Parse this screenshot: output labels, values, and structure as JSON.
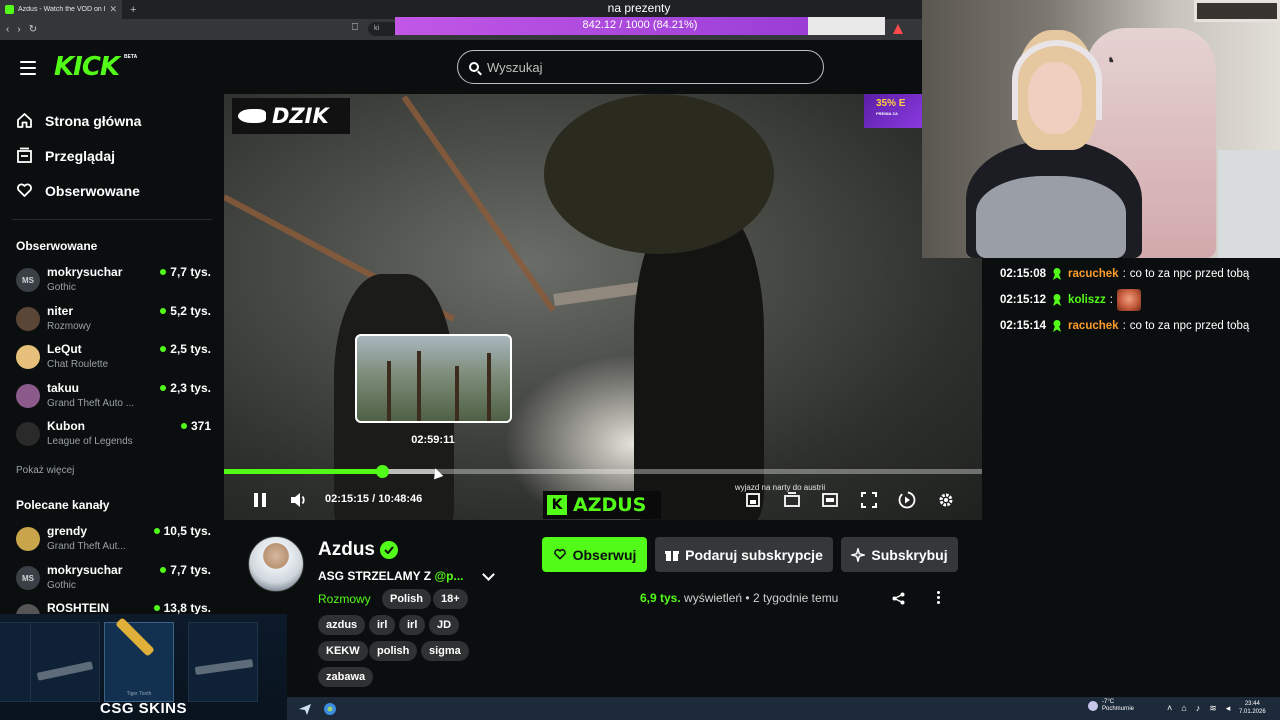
{
  "browser": {
    "tab_title": "Azdus - Watch the VOD on K",
    "url_fragment": "ki"
  },
  "goal_overlay": {
    "label": "na prezenty",
    "progress_text": "842.12 / 1000 (84.21%)",
    "progress_fraction": 0.8421
  },
  "header": {
    "logo": "KICK",
    "beta": "BETA",
    "search_placeholder": "Wyszukaj"
  },
  "sidebar": {
    "nav": [
      {
        "label": "Strona główna",
        "icon": "home-icon"
      },
      {
        "label": "Przeglądaj",
        "icon": "browse-icon"
      },
      {
        "label": "Obserwowane",
        "icon": "heart-icon"
      }
    ],
    "followed_title": "Obserwowane",
    "followed": [
      {
        "name": "mokrysuchar",
        "category": "Gothic",
        "viewers": "7,7 tys.",
        "initials": "MS"
      },
      {
        "name": "niter",
        "category": "Rozmowy",
        "viewers": "5,2 tys.",
        "initials": ""
      },
      {
        "name": "LeQut",
        "category": "Chat Roulette",
        "viewers": "2,5 tys.",
        "initials": ""
      },
      {
        "name": "takuu",
        "category": "Grand Theft Auto ...",
        "viewers": "2,3 tys.",
        "initials": ""
      },
      {
        "name": "Kubon",
        "category": "League of Legends",
        "viewers": "371",
        "initials": ""
      }
    ],
    "show_more": "Pokaż więcej",
    "recommended_title": "Polecane kanały",
    "recommended": [
      {
        "name": "grendy",
        "category": "Grand Theft Aut...",
        "viewers": "10,5 tys.",
        "initials": ""
      },
      {
        "name": "mokrysuchar",
        "category": "Gothic",
        "viewers": "7,7 tys.",
        "initials": "MS"
      },
      {
        "name": "ROSHTEIN",
        "category": "",
        "viewers": "13,8 tys.",
        "initials": ""
      }
    ]
  },
  "csgo_ad": {
    "brand": "CSG SKINS",
    "items": [
      "Tiger Tooth"
    ]
  },
  "video": {
    "overlay_logo": "DZIK",
    "promo": "35% E",
    "promo_sub": "PREMIA ZA",
    "preview_time": "02:59:11",
    "streamer_tag": "AZDUS",
    "streamer_tag_k": "K",
    "stream_caption": "wyjazd na narty do austrii",
    "current_time": "02:15:15",
    "separator": "/",
    "duration": "10:48:46",
    "played_fraction": 0.2085,
    "buffered_fraction": 0.28
  },
  "stream": {
    "name": "Azdus",
    "title_prefix": "ASG STRZELAMY Z ",
    "title_mention": "@p...",
    "category": "Rozmowy",
    "language": "Polish",
    "age": "18+",
    "tags": [
      "azdus",
      "irl",
      "irl",
      "JD",
      "KEKW",
      "polish",
      "sigma",
      "zabawa"
    ],
    "follow_label": "Obserwuj",
    "gift_label": "Podaruj subskrypcje",
    "sub_label": "Subskrybuj",
    "views_count": "6,9 tys.",
    "views_label": "wyświetleń",
    "bullet": "•",
    "age_label": "2 tygodnie temu"
  },
  "chat": [
    {
      "time": "02:15:08",
      "user": "racuchek",
      "user_color": "#ff9d2a",
      "text": "co to za npc przed tobą",
      "emote": false
    },
    {
      "time": "02:15:12",
      "user": "koliszz",
      "user_color": "#53fc18",
      "text": "",
      "emote": true
    },
    {
      "time": "02:15:14",
      "user": "racuchek",
      "user_color": "#ff9d2a",
      "text": "co to za npc przed tobą",
      "emote": false
    }
  ],
  "taskbar": {
    "temp": "-7°C",
    "weather": "Pochmurnie",
    "time": "23:44",
    "date": "7.01.2026"
  },
  "colors": {
    "accent": "#53fc18",
    "bg": "#0b0e0f",
    "goal_fill": "#b44ee0"
  }
}
